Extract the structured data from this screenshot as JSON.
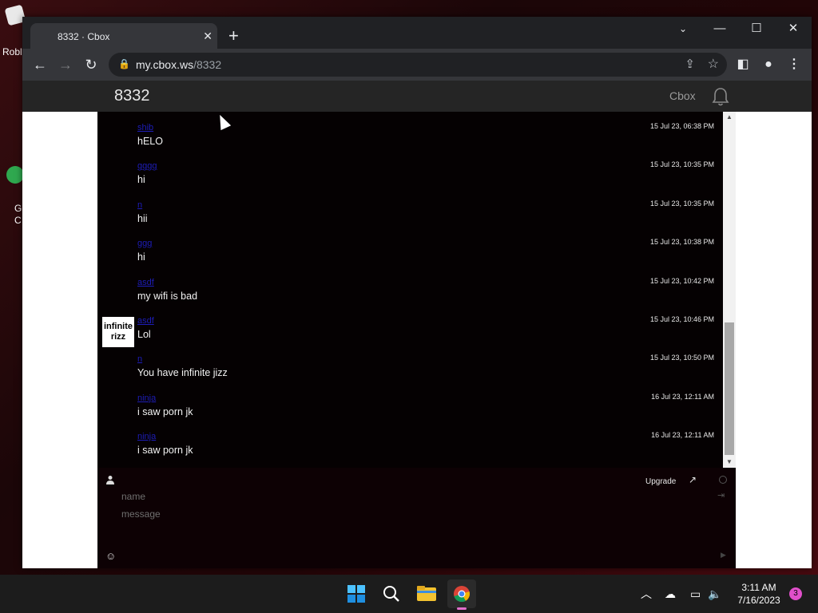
{
  "desktop": {
    "icons": [
      {
        "label": "Robl",
        "icon": "roblox-icon"
      },
      {
        "label": "G\nC",
        "icon": "chrome-shortcut-icon"
      }
    ]
  },
  "browser": {
    "tab_title": "8332 · Cbox",
    "url_host": "my.cbox.ws",
    "url_path": "/8332",
    "icons": {
      "back": "←",
      "forward": "→",
      "reload": "↻",
      "lock": "🔒",
      "share": "⇪",
      "star": "☆",
      "new_tab": "+",
      "close_tab": "✕",
      "minimize": "—",
      "maximize": "☐",
      "close": "✕",
      "tab_search": "⌄",
      "side_panel": "◧",
      "profile": "●",
      "menu": "⋮"
    }
  },
  "cbox": {
    "room_name": "8332",
    "brand": "Cbox",
    "colors": {
      "name_link": "#1d1db8",
      "chat_bg": "#050102",
      "header_bg": "#252525"
    },
    "messages": [
      {
        "name": "shib",
        "time": "15 Jul 23, 06:38 PM",
        "text": "hELO",
        "avatar": ""
      },
      {
        "name": "gggg",
        "time": "15 Jul 23, 10:35 PM",
        "text": "hi",
        "avatar": ""
      },
      {
        "name": "n",
        "time": "15 Jul 23, 10:35 PM",
        "text": "hii",
        "avatar": ""
      },
      {
        "name": "ggg",
        "time": "15 Jul 23, 10:38 PM",
        "text": "hi",
        "avatar": ""
      },
      {
        "name": "asdf",
        "time": "15 Jul 23, 10:42 PM",
        "text": "my wifi is bad",
        "avatar": ""
      },
      {
        "name": "asdf",
        "time": "15 Jul 23, 10:46 PM",
        "text": "Lol",
        "avatar": "infinite rizz"
      },
      {
        "name": "n",
        "time": "15 Jul 23, 10:50 PM",
        "text": "You have infinite jizz",
        "avatar": ""
      },
      {
        "name": "ninja",
        "time": "16 Jul 23, 12:11 AM",
        "text": "i saw porn jk",
        "avatar": ""
      },
      {
        "name": "ninja",
        "time": "16 Jul 23, 12:11 AM",
        "text": "i saw porn jk",
        "avatar": ""
      }
    ],
    "form": {
      "upgrade_label": "Upgrade",
      "name_placeholder": "name",
      "message_placeholder": "message",
      "name_value": "",
      "message_value": ""
    }
  },
  "taskbar": {
    "time": "3:11 AM",
    "date": "7/16/2023",
    "notification_count": "3",
    "apps": [
      "start-icon",
      "search-icon",
      "file-explorer-icon",
      "chrome-icon"
    ]
  }
}
